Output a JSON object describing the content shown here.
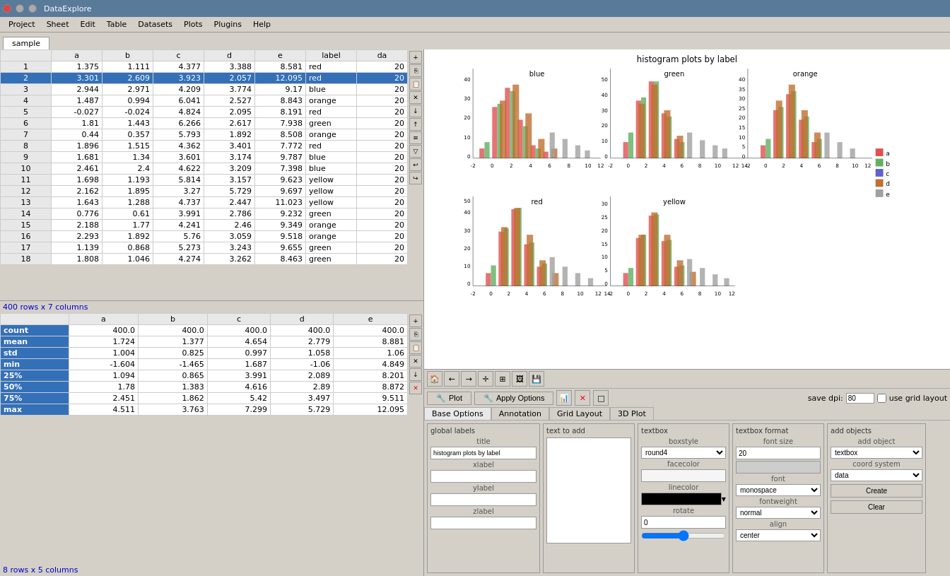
{
  "app": {
    "title": "DataExplore",
    "tab": "sample"
  },
  "menu": {
    "items": [
      "Project",
      "Sheet",
      "Edit",
      "Table",
      "Datasets",
      "Plots",
      "Plugins",
      "Help"
    ]
  },
  "table": {
    "columns": [
      "a",
      "b",
      "c",
      "d",
      "e",
      "label",
      "da"
    ],
    "rows": [
      {
        "num": 1,
        "a": "1.375",
        "b": "1.111",
        "c": "4.377",
        "d": "3.388",
        "e": "8.581",
        "label": "red",
        "da": "20"
      },
      {
        "num": 2,
        "a": "3.301",
        "b": "2.609",
        "c": "3.923",
        "d": "2.057",
        "e": "12.095",
        "label": "red",
        "da": "20"
      },
      {
        "num": 3,
        "a": "2.944",
        "b": "2.971",
        "c": "4.209",
        "d": "3.774",
        "e": "9.17",
        "label": "blue",
        "da": "20"
      },
      {
        "num": 4,
        "a": "1.487",
        "b": "0.994",
        "c": "6.041",
        "d": "2.527",
        "e": "8.843",
        "label": "orange",
        "da": "20"
      },
      {
        "num": 5,
        "a": "-0.027",
        "b": "-0.024",
        "c": "4.824",
        "d": "2.095",
        "e": "8.191",
        "label": "red",
        "da": "20"
      },
      {
        "num": 6,
        "a": "1.81",
        "b": "1.443",
        "c": "6.266",
        "d": "2.617",
        "e": "7.938",
        "label": "green",
        "da": "20"
      },
      {
        "num": 7,
        "a": "0.44",
        "b": "0.357",
        "c": "5.793",
        "d": "1.892",
        "e": "8.508",
        "label": "orange",
        "da": "20"
      },
      {
        "num": 8,
        "a": "1.896",
        "b": "1.515",
        "c": "4.362",
        "d": "3.401",
        "e": "7.772",
        "label": "red",
        "da": "20"
      },
      {
        "num": 9,
        "a": "1.681",
        "b": "1.34",
        "c": "3.601",
        "d": "3.174",
        "e": "9.787",
        "label": "blue",
        "da": "20"
      },
      {
        "num": 10,
        "a": "2.461",
        "b": "2.4",
        "c": "4.622",
        "d": "3.209",
        "e": "7.398",
        "label": "blue",
        "da": "20"
      },
      {
        "num": 11,
        "a": "1.698",
        "b": "1.193",
        "c": "5.814",
        "d": "3.157",
        "e": "9.623",
        "label": "yellow",
        "da": "20"
      },
      {
        "num": 12,
        "a": "2.162",
        "b": "1.895",
        "c": "3.27",
        "d": "5.729",
        "e": "9.697",
        "label": "yellow",
        "da": "20"
      },
      {
        "num": 13,
        "a": "1.643",
        "b": "1.288",
        "c": "4.737",
        "d": "2.447",
        "e": "11.023",
        "label": "yellow",
        "da": "20"
      },
      {
        "num": 14,
        "a": "0.776",
        "b": "0.61",
        "c": "3.991",
        "d": "2.786",
        "e": "9.232",
        "label": "green",
        "da": "20"
      },
      {
        "num": 15,
        "a": "2.188",
        "b": "1.77",
        "c": "4.241",
        "d": "2.46",
        "e": "9.349",
        "label": "orange",
        "da": "20"
      },
      {
        "num": 16,
        "a": "2.293",
        "b": "1.892",
        "c": "5.76",
        "d": "3.059",
        "e": "9.518",
        "label": "orange",
        "da": "20"
      },
      {
        "num": 17,
        "a": "1.139",
        "b": "0.868",
        "c": "5.273",
        "d": "3.243",
        "e": "9.655",
        "label": "green",
        "da": "20"
      },
      {
        "num": 18,
        "a": "1.808",
        "b": "1.046",
        "c": "4.274",
        "d": "3.262",
        "e": "8.463",
        "label": "green",
        "da": "20"
      }
    ],
    "row_count": "400 rows x 7 columns"
  },
  "stats": {
    "columns": [
      "a",
      "b",
      "c",
      "d",
      "e"
    ],
    "rows": [
      {
        "label": "count",
        "a": "400.0",
        "b": "400.0",
        "c": "400.0",
        "d": "400.0",
        "e": "400.0"
      },
      {
        "label": "mean",
        "a": "1.724",
        "b": "1.377",
        "c": "4.654",
        "d": "2.779",
        "e": "8.881"
      },
      {
        "label": "std",
        "a": "1.004",
        "b": "0.825",
        "c": "0.997",
        "d": "1.058",
        "e": "1.06"
      },
      {
        "label": "min",
        "a": "-1.604",
        "b": "-1.465",
        "c": "1.687",
        "d": "-1.06",
        "e": "4.849"
      },
      {
        "label": "25%",
        "a": "1.094",
        "b": "0.865",
        "c": "3.991",
        "d": "2.089",
        "e": "8.201"
      },
      {
        "label": "50%",
        "a": "1.78",
        "b": "1.383",
        "c": "4.616",
        "d": "2.89",
        "e": "8.872"
      },
      {
        "label": "75%",
        "a": "2.451",
        "b": "1.862",
        "c": "5.42",
        "d": "3.497",
        "e": "9.511"
      },
      {
        "label": "max",
        "a": "4.511",
        "b": "3.763",
        "c": "7.299",
        "d": "5.729",
        "e": "12.095"
      }
    ],
    "row_count": "8 rows x 5 columns"
  },
  "plot": {
    "title": "histogram plots by label",
    "plot_btn": "Plot",
    "apply_btn": "Apply Options",
    "save_dpi_label": "save dpi:",
    "save_dpi_value": "80",
    "grid_layout_label": "use grid layout",
    "tabs": [
      "Base Options",
      "Annotation",
      "Grid Layout",
      "3D Plot"
    ],
    "active_tab": "Base Options"
  },
  "options": {
    "global_labels": {
      "title": "global labels",
      "title_label": "title",
      "title_value": "histogram plots by label",
      "xlabel_label": "xlabel",
      "xlabel_value": "",
      "ylabel_label": "ylabel",
      "ylabel_value": "",
      "zlabel_label": "zlabel",
      "zlabel_value": ""
    },
    "text_to_add": {
      "title": "text to add",
      "text_area_value": ""
    },
    "textbox": {
      "title": "textbox",
      "boxstyle_label": "boxstyle",
      "boxstyle_value": "round4",
      "facecolor_label": "facecolor",
      "facecolor_value": "whitesmoke",
      "linecolor_label": "linecolor",
      "linecolor_value": "black",
      "rotate_label": "rotate",
      "rotate_value": "0"
    },
    "textbox_format": {
      "title": "textbox format",
      "fontsize_label": "font size",
      "fontsize_value": "20",
      "font_label": "font",
      "font_value": "monospace",
      "fontweight_label": "fontweight",
      "fontweight_value": "normal",
      "align_label": "align",
      "align_value": "center"
    },
    "add_objects": {
      "title": "add objects",
      "add_object_label": "add object",
      "add_object_value": "textbox",
      "coord_system_label": "coord system",
      "coord_system_value": "data",
      "create_btn": "Create",
      "clear_btn": "Clear"
    }
  },
  "legend": {
    "items": [
      {
        "label": "a",
        "color": "#e05050"
      },
      {
        "label": "b",
        "color": "#60b060"
      },
      {
        "label": "c",
        "color": "#5050e0"
      },
      {
        "label": "d",
        "color": "#c07030"
      },
      {
        "label": "e",
        "color": "#a0a0a0"
      }
    ]
  },
  "histograms": {
    "blue": {
      "title": "blue",
      "xmin": -2,
      "xmax": 12
    },
    "green": {
      "title": "green",
      "xmin": -2,
      "xmax": 14
    },
    "orange": {
      "title": "orange",
      "xmin": -2,
      "xmax": 12
    },
    "red": {
      "title": "red",
      "xmin": -2,
      "xmax": 14
    },
    "yellow": {
      "title": "yellow",
      "xmin": -2,
      "xmax": 12
    }
  }
}
